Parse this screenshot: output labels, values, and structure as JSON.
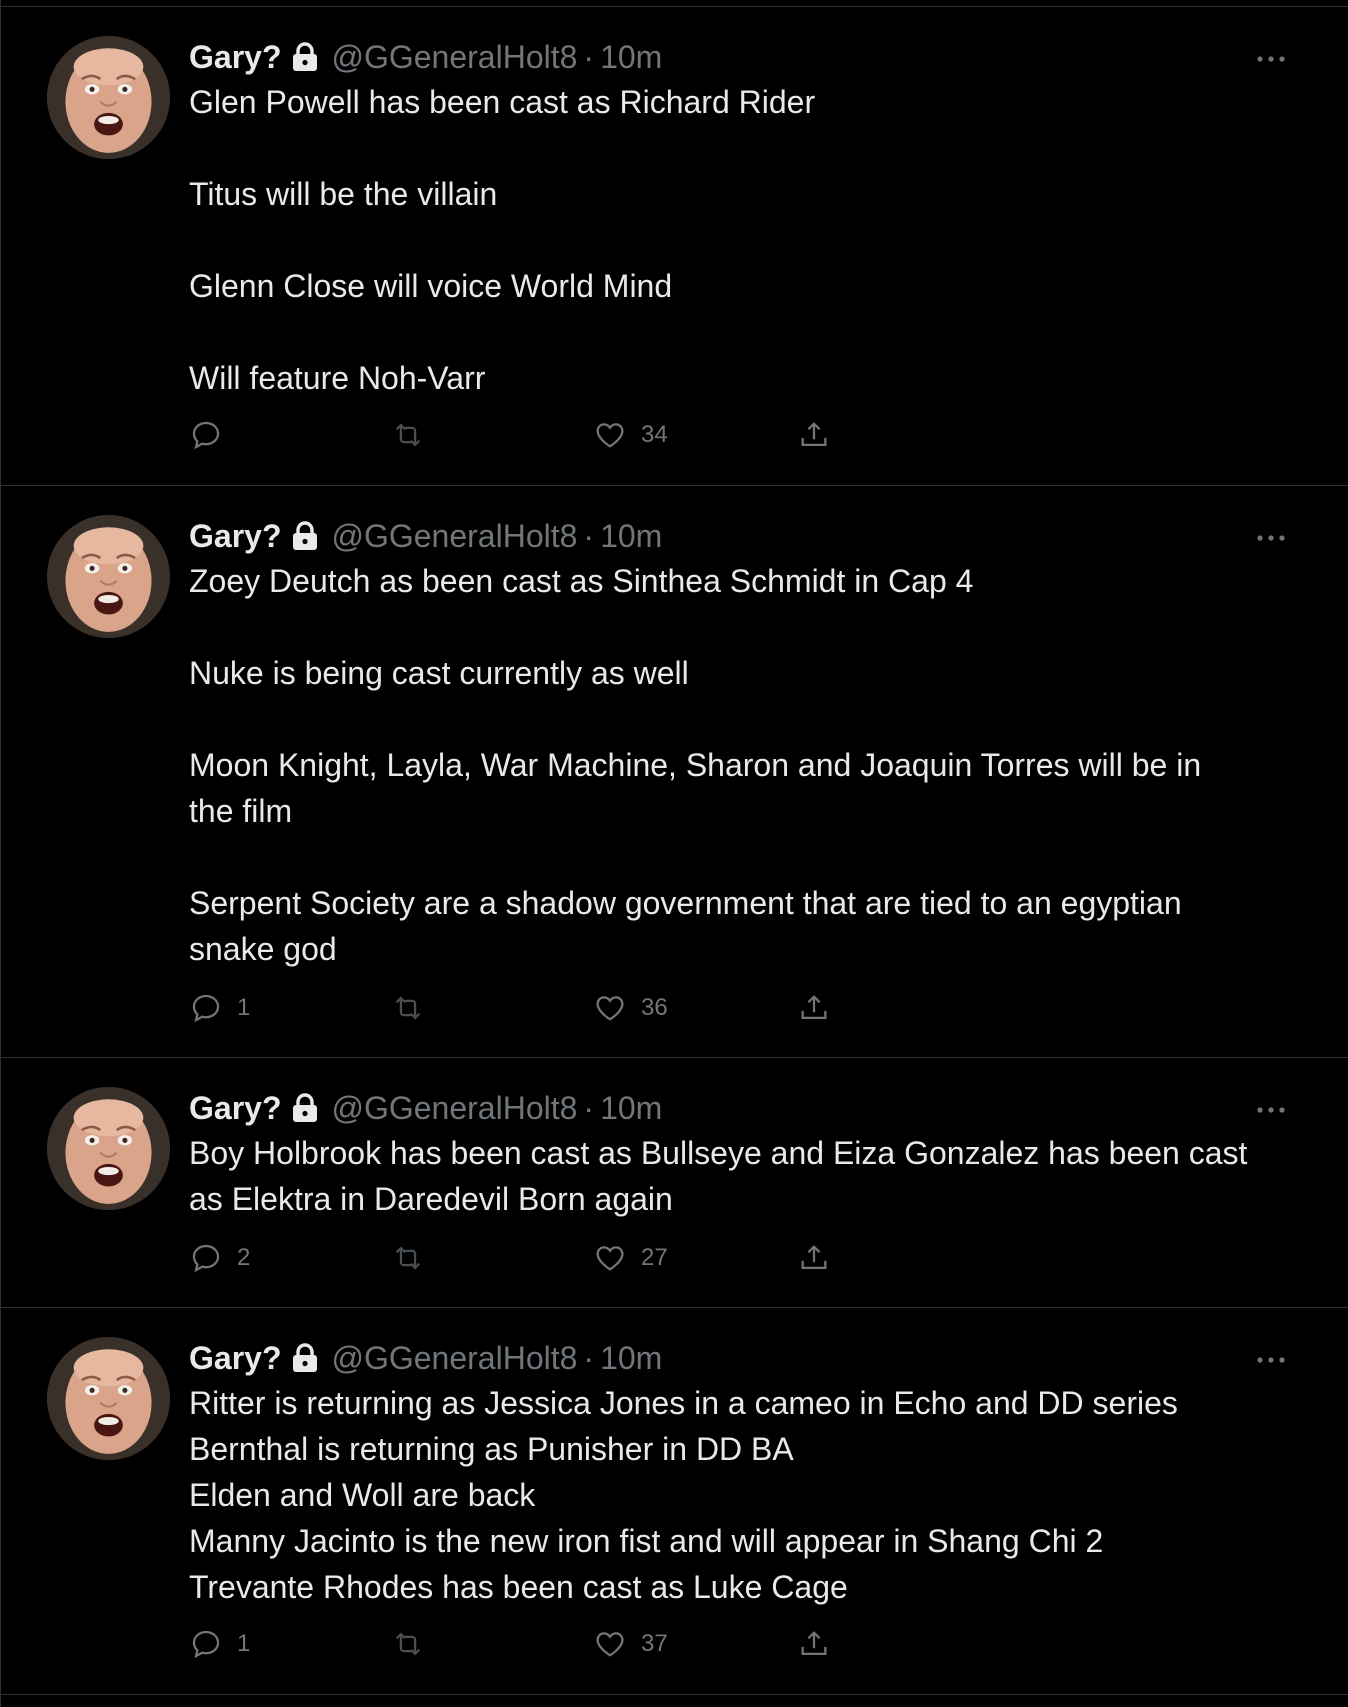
{
  "colors": {
    "background": "#000000",
    "divider": "#2f3336",
    "text_primary": "#e7e9ea",
    "text_secondary": "#71767b"
  },
  "icons": {
    "lock": "lock-icon",
    "more": "more-options-icon",
    "reply": "reply-icon",
    "retweet": "retweet-icon",
    "like": "heart-icon",
    "share": "share-icon"
  },
  "tweets": [
    {
      "author": "Gary?",
      "handle": "@GGeneralHolt8",
      "separator": "·",
      "time": "10m",
      "paragraphs": [
        "Glen Powell has been cast as Richard Rider",
        "Titus will be the villain",
        "Glenn Close will voice World Mind",
        "Will feature Noh-Varr"
      ],
      "replies": "",
      "retweets": "",
      "likes": "34"
    },
    {
      "author": "Gary?",
      "handle": "@GGeneralHolt8",
      "separator": "·",
      "time": "10m",
      "paragraphs": [
        "Zoey Deutch as been cast as Sinthea Schmidt in Cap 4",
        "Nuke is being cast currently as well",
        "Moon Knight, Layla, War Machine, Sharon and Joaquin Torres will be in\nthe film",
        "Serpent Society are a shadow government that are tied to an egyptian\nsnake god"
      ],
      "replies": "1",
      "retweets": "",
      "likes": "36"
    },
    {
      "author": "Gary?",
      "handle": "@GGeneralHolt8",
      "separator": "·",
      "time": "10m",
      "paragraphs": [
        "Boy Holbrook has been cast as Bullseye and Eiza Gonzalez has been cast\nas Elektra in Daredevil Born again"
      ],
      "replies": "2",
      "retweets": "",
      "likes": "27"
    },
    {
      "author": "Gary?",
      "handle": "@GGeneralHolt8",
      "separator": "·",
      "time": "10m",
      "paragraphs": [
        "Ritter is returning as Jessica Jones in a cameo in Echo and DD series\nBernthal is returning as Punisher in DD BA\nElden and Woll are back\nManny Jacinto is the new iron fist and will appear in Shang Chi 2\nTrevante Rhodes has been cast as Luke Cage"
      ],
      "replies": "1",
      "retweets": "",
      "likes": "37"
    }
  ]
}
